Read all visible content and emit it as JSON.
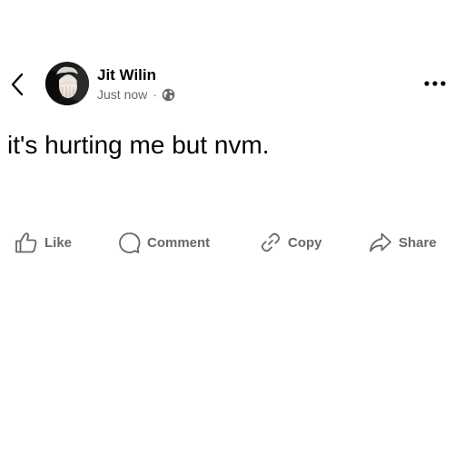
{
  "post": {
    "author_name": "Jit Wilin",
    "timestamp": "Just now",
    "separator": "·",
    "privacy_icon": "globe-icon",
    "text": "it's hurting me but nvm."
  },
  "header": {
    "back_icon": "chevron-left-icon",
    "more_icon": "more-horizontal-icon"
  },
  "actions": {
    "like_label": "Like",
    "comment_label": "Comment",
    "copy_label": "Copy",
    "share_label": "Share"
  },
  "colors": {
    "primary_text": "#050505",
    "secondary_text": "#65676b",
    "background": "#ffffff"
  }
}
